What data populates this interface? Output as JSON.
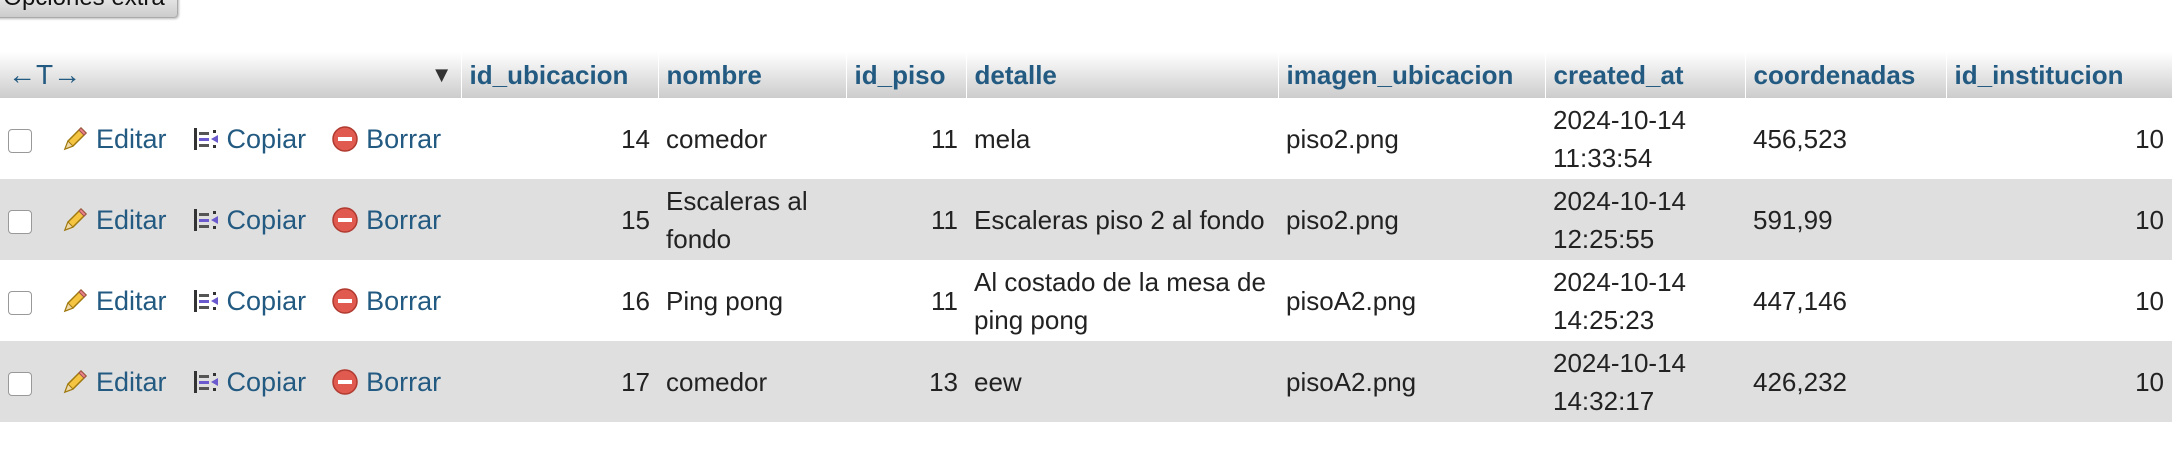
{
  "toolbar": {
    "extra_options_label": "Opciones extra"
  },
  "header": {
    "arrows": "←T→",
    "columns": [
      "id_ubicacion",
      "nombre",
      "id_piso",
      "detalle",
      "imagen_ubicacion",
      "created_at",
      "coordenadas",
      "id_institucion"
    ]
  },
  "actions": {
    "edit": "Editar",
    "copy": "Copiar",
    "delete": "Borrar"
  },
  "rows": [
    {
      "id_ubicacion": "14",
      "nombre": "comedor",
      "id_piso": "11",
      "detalle": "mela",
      "imagen_ubicacion": "piso2.png",
      "created_at_date": "2024-10-14",
      "created_at_time": "11:33:54",
      "coordenadas": "456,523",
      "id_institucion": "10"
    },
    {
      "id_ubicacion": "15",
      "nombre": "Escaleras al fondo",
      "id_piso": "11",
      "detalle": "Escaleras piso 2 al fondo",
      "imagen_ubicacion": "piso2.png",
      "created_at_date": "2024-10-14",
      "created_at_time": "12:25:55",
      "coordenadas": "591,99",
      "id_institucion": "10"
    },
    {
      "id_ubicacion": "16",
      "nombre": "Ping pong",
      "id_piso": "11",
      "detalle": "Al costado de la mesa de ping pong",
      "imagen_ubicacion": "pisoA2.png",
      "created_at_date": "2024-10-14",
      "created_at_time": "14:25:23",
      "coordenadas": "447,146",
      "id_institucion": "10"
    },
    {
      "id_ubicacion": "17",
      "nombre": "comedor",
      "id_piso": "13",
      "detalle": "eew",
      "imagen_ubicacion": "pisoA2.png",
      "created_at_date": "2024-10-14",
      "created_at_time": "14:32:17",
      "coordenadas": "426,232",
      "id_institucion": "10"
    }
  ]
}
